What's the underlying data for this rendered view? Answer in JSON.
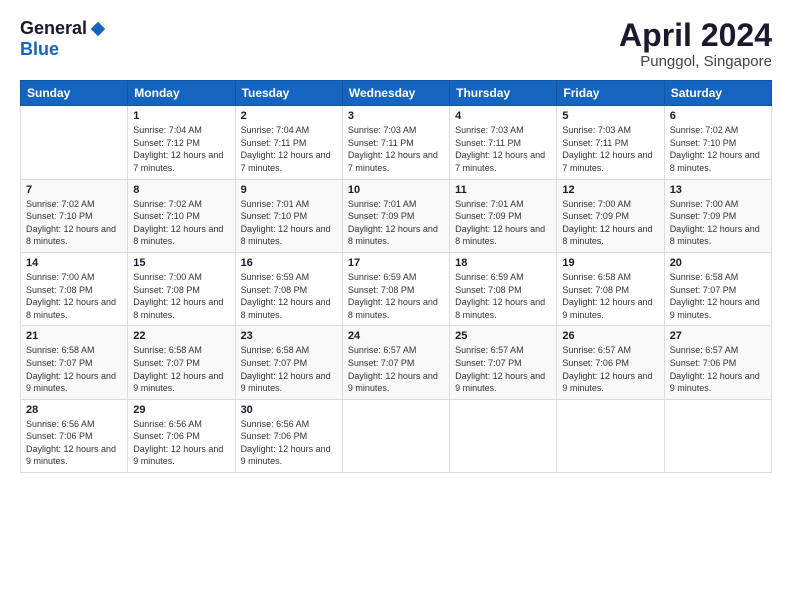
{
  "logo": {
    "general": "General",
    "blue": "Blue"
  },
  "header": {
    "title": "April 2024",
    "location": "Punggol, Singapore"
  },
  "weekdays": [
    "Sunday",
    "Monday",
    "Tuesday",
    "Wednesday",
    "Thursday",
    "Friday",
    "Saturday"
  ],
  "weeks": [
    [
      {
        "day": "",
        "sunrise": "",
        "sunset": "",
        "daylight": ""
      },
      {
        "day": "1",
        "sunrise": "Sunrise: 7:04 AM",
        "sunset": "Sunset: 7:12 PM",
        "daylight": "Daylight: 12 hours and 7 minutes."
      },
      {
        "day": "2",
        "sunrise": "Sunrise: 7:04 AM",
        "sunset": "Sunset: 7:11 PM",
        "daylight": "Daylight: 12 hours and 7 minutes."
      },
      {
        "day": "3",
        "sunrise": "Sunrise: 7:03 AM",
        "sunset": "Sunset: 7:11 PM",
        "daylight": "Daylight: 12 hours and 7 minutes."
      },
      {
        "day": "4",
        "sunrise": "Sunrise: 7:03 AM",
        "sunset": "Sunset: 7:11 PM",
        "daylight": "Daylight: 12 hours and 7 minutes."
      },
      {
        "day": "5",
        "sunrise": "Sunrise: 7:03 AM",
        "sunset": "Sunset: 7:11 PM",
        "daylight": "Daylight: 12 hours and 7 minutes."
      },
      {
        "day": "6",
        "sunrise": "Sunrise: 7:02 AM",
        "sunset": "Sunset: 7:10 PM",
        "daylight": "Daylight: 12 hours and 8 minutes."
      }
    ],
    [
      {
        "day": "7",
        "sunrise": "Sunrise: 7:02 AM",
        "sunset": "Sunset: 7:10 PM",
        "daylight": "Daylight: 12 hours and 8 minutes."
      },
      {
        "day": "8",
        "sunrise": "Sunrise: 7:02 AM",
        "sunset": "Sunset: 7:10 PM",
        "daylight": "Daylight: 12 hours and 8 minutes."
      },
      {
        "day": "9",
        "sunrise": "Sunrise: 7:01 AM",
        "sunset": "Sunset: 7:10 PM",
        "daylight": "Daylight: 12 hours and 8 minutes."
      },
      {
        "day": "10",
        "sunrise": "Sunrise: 7:01 AM",
        "sunset": "Sunset: 7:09 PM",
        "daylight": "Daylight: 12 hours and 8 minutes."
      },
      {
        "day": "11",
        "sunrise": "Sunrise: 7:01 AM",
        "sunset": "Sunset: 7:09 PM",
        "daylight": "Daylight: 12 hours and 8 minutes."
      },
      {
        "day": "12",
        "sunrise": "Sunrise: 7:00 AM",
        "sunset": "Sunset: 7:09 PM",
        "daylight": "Daylight: 12 hours and 8 minutes."
      },
      {
        "day": "13",
        "sunrise": "Sunrise: 7:00 AM",
        "sunset": "Sunset: 7:09 PM",
        "daylight": "Daylight: 12 hours and 8 minutes."
      }
    ],
    [
      {
        "day": "14",
        "sunrise": "Sunrise: 7:00 AM",
        "sunset": "Sunset: 7:08 PM",
        "daylight": "Daylight: 12 hours and 8 minutes."
      },
      {
        "day": "15",
        "sunrise": "Sunrise: 7:00 AM",
        "sunset": "Sunset: 7:08 PM",
        "daylight": "Daylight: 12 hours and 8 minutes."
      },
      {
        "day": "16",
        "sunrise": "Sunrise: 6:59 AM",
        "sunset": "Sunset: 7:08 PM",
        "daylight": "Daylight: 12 hours and 8 minutes."
      },
      {
        "day": "17",
        "sunrise": "Sunrise: 6:59 AM",
        "sunset": "Sunset: 7:08 PM",
        "daylight": "Daylight: 12 hours and 8 minutes."
      },
      {
        "day": "18",
        "sunrise": "Sunrise: 6:59 AM",
        "sunset": "Sunset: 7:08 PM",
        "daylight": "Daylight: 12 hours and 8 minutes."
      },
      {
        "day": "19",
        "sunrise": "Sunrise: 6:58 AM",
        "sunset": "Sunset: 7:08 PM",
        "daylight": "Daylight: 12 hours and 9 minutes."
      },
      {
        "day": "20",
        "sunrise": "Sunrise: 6:58 AM",
        "sunset": "Sunset: 7:07 PM",
        "daylight": "Daylight: 12 hours and 9 minutes."
      }
    ],
    [
      {
        "day": "21",
        "sunrise": "Sunrise: 6:58 AM",
        "sunset": "Sunset: 7:07 PM",
        "daylight": "Daylight: 12 hours and 9 minutes."
      },
      {
        "day": "22",
        "sunrise": "Sunrise: 6:58 AM",
        "sunset": "Sunset: 7:07 PM",
        "daylight": "Daylight: 12 hours and 9 minutes."
      },
      {
        "day": "23",
        "sunrise": "Sunrise: 6:58 AM",
        "sunset": "Sunset: 7:07 PM",
        "daylight": "Daylight: 12 hours and 9 minutes."
      },
      {
        "day": "24",
        "sunrise": "Sunrise: 6:57 AM",
        "sunset": "Sunset: 7:07 PM",
        "daylight": "Daylight: 12 hours and 9 minutes."
      },
      {
        "day": "25",
        "sunrise": "Sunrise: 6:57 AM",
        "sunset": "Sunset: 7:07 PM",
        "daylight": "Daylight: 12 hours and 9 minutes."
      },
      {
        "day": "26",
        "sunrise": "Sunrise: 6:57 AM",
        "sunset": "Sunset: 7:06 PM",
        "daylight": "Daylight: 12 hours and 9 minutes."
      },
      {
        "day": "27",
        "sunrise": "Sunrise: 6:57 AM",
        "sunset": "Sunset: 7:06 PM",
        "daylight": "Daylight: 12 hours and 9 minutes."
      }
    ],
    [
      {
        "day": "28",
        "sunrise": "Sunrise: 6:56 AM",
        "sunset": "Sunset: 7:06 PM",
        "daylight": "Daylight: 12 hours and 9 minutes."
      },
      {
        "day": "29",
        "sunrise": "Sunrise: 6:56 AM",
        "sunset": "Sunset: 7:06 PM",
        "daylight": "Daylight: 12 hours and 9 minutes."
      },
      {
        "day": "30",
        "sunrise": "Sunrise: 6:56 AM",
        "sunset": "Sunset: 7:06 PM",
        "daylight": "Daylight: 12 hours and 9 minutes."
      },
      {
        "day": "",
        "sunrise": "",
        "sunset": "",
        "daylight": ""
      },
      {
        "day": "",
        "sunrise": "",
        "sunset": "",
        "daylight": ""
      },
      {
        "day": "",
        "sunrise": "",
        "sunset": "",
        "daylight": ""
      },
      {
        "day": "",
        "sunrise": "",
        "sunset": "",
        "daylight": ""
      }
    ]
  ]
}
